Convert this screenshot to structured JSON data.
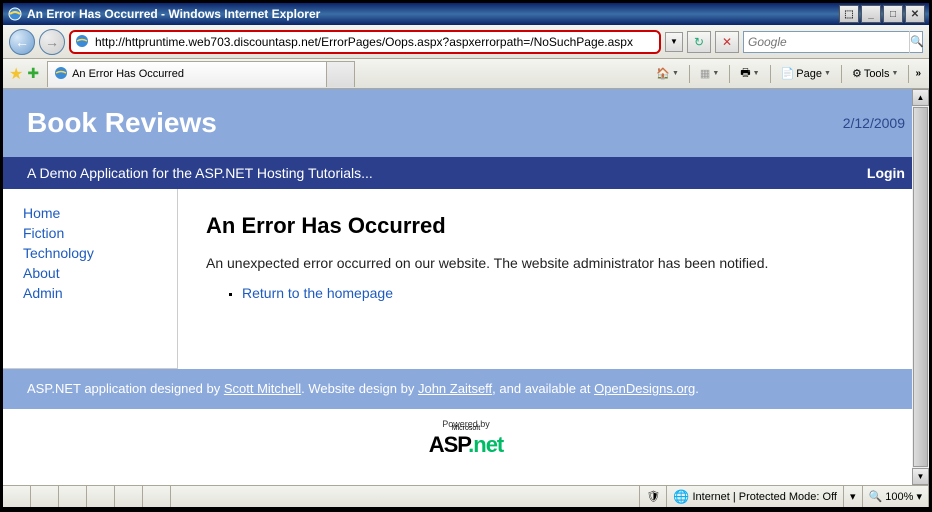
{
  "window": {
    "title": "An Error Has Occurred - Windows Internet Explorer"
  },
  "nav": {
    "url": "http://httpruntime.web703.discountasp.net/ErrorPages/Oops.aspx?aspxerrorpath=/NoSuchPage.aspx",
    "search_placeholder": "Google"
  },
  "tab": {
    "title": "An Error Has Occurred"
  },
  "toolbar": {
    "page": "Page",
    "tools": "Tools"
  },
  "site": {
    "title": "Book Reviews",
    "date": "2/12/2009",
    "tagline": "A Demo Application for the ASP.NET Hosting Tutorials...",
    "login": "Login"
  },
  "sidebar": {
    "items": [
      {
        "label": "Home"
      },
      {
        "label": "Fiction"
      },
      {
        "label": "Technology"
      },
      {
        "label": "About"
      },
      {
        "label": "Admin"
      }
    ]
  },
  "error": {
    "heading": "An Error Has Occurred",
    "message": "An unexpected error occurred on our website. The website administrator has been notified.",
    "link": "Return to the homepage"
  },
  "footer": {
    "prefix": "ASP.NET application designed by ",
    "author": "Scott Mitchell",
    "mid": ". Website design by ",
    "designer": "John Zaitseff",
    "suffix": ", and available at ",
    "source": "OpenDesigns.org",
    "end": "."
  },
  "powered": {
    "label": "Powered by",
    "ms": "Microsoft"
  },
  "status": {
    "zone": "Internet | Protected Mode: Off",
    "zoom": "100%"
  }
}
